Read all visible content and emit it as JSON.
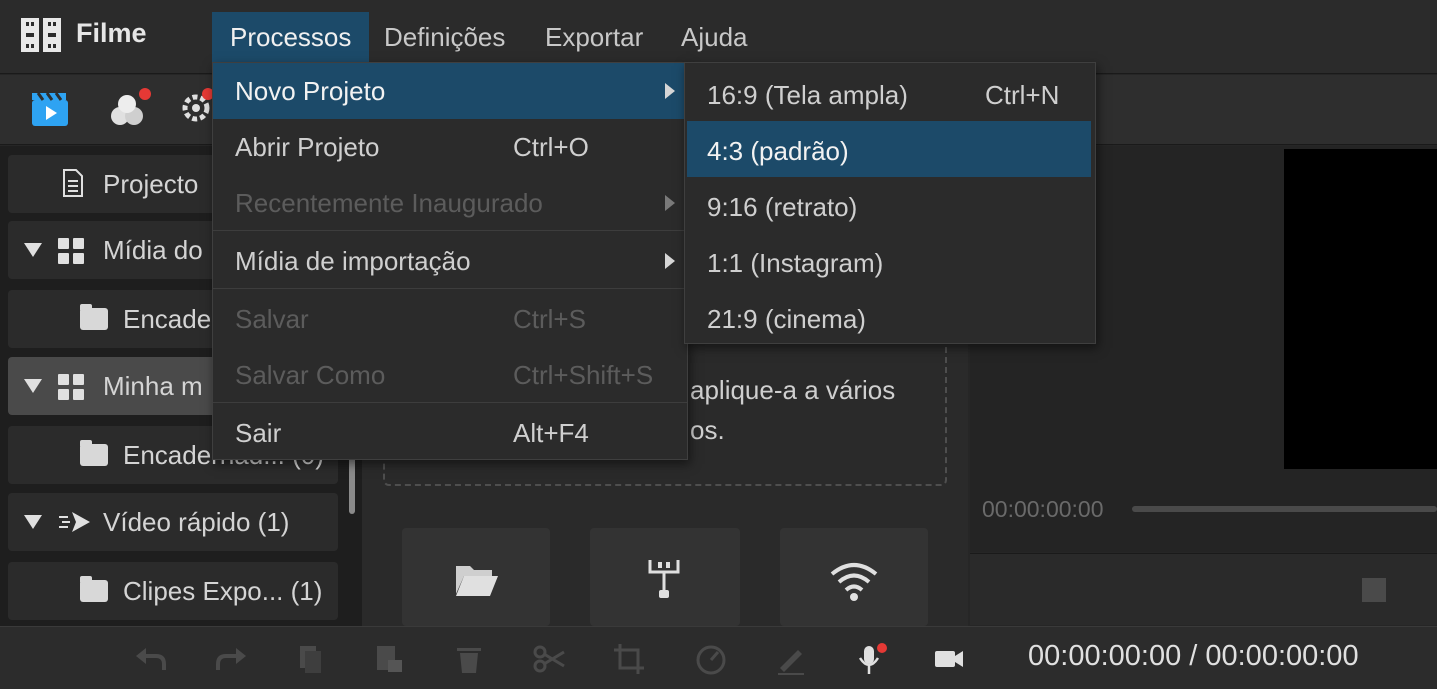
{
  "app": {
    "title": "Filme"
  },
  "menubar": {
    "items": [
      {
        "label": "Processos",
        "active": true
      },
      {
        "label": "Definições"
      },
      {
        "label": "Exportar"
      },
      {
        "label": "Ajuda"
      }
    ]
  },
  "toolbar": {
    "icons": [
      "media-clapper-icon",
      "effects-icon",
      "gear-sparkle-icon"
    ]
  },
  "sidebar": {
    "items": [
      {
        "label": "Projecto",
        "icon": "document-icon"
      },
      {
        "label": "Mídia do",
        "icon": "grid-icon"
      },
      {
        "label": "Encade",
        "icon": "folder-icon"
      },
      {
        "label": "Minha m",
        "icon": "grid-icon",
        "selected": true
      },
      {
        "label": "Encadernad... (0)",
        "icon": "folder-icon"
      },
      {
        "label": "Vídeo rápido (1)",
        "icon": "fast-forward-icon"
      },
      {
        "label": "Clipes Expo... (1)",
        "icon": "folder-icon"
      }
    ]
  },
  "center": {
    "drop_text_line1": "aplique-a a vários",
    "drop_text_line2": "os."
  },
  "preview": {
    "time": "00:00:00:00"
  },
  "bottombar": {
    "timecode": "00:00:00:00 / 00:00:00:00"
  },
  "process_menu": {
    "items": [
      {
        "label": "Novo Projeto",
        "shortcut": "",
        "submenu": true,
        "highlighted": true
      },
      {
        "label": "Abrir Projeto",
        "shortcut": "Ctrl+O"
      },
      {
        "label": "Recentemente Inaugurado",
        "shortcut": "",
        "submenu": true,
        "disabled": true
      },
      {
        "label": "Mídia de importação",
        "shortcut": "",
        "submenu": true
      },
      {
        "label": "Salvar",
        "shortcut": "Ctrl+S",
        "disabled": true
      },
      {
        "label": "Salvar Como",
        "shortcut": "Ctrl+Shift+S",
        "disabled": true
      },
      {
        "label": "Sair",
        "shortcut": "Alt+F4"
      }
    ]
  },
  "new_project_submenu": {
    "items": [
      {
        "label": "16:9 (Tela ampla)",
        "shortcut": "Ctrl+N"
      },
      {
        "label": "4:3 (padrão)",
        "shortcut": "",
        "highlighted": true
      },
      {
        "label": "9:16 (retrato)",
        "shortcut": ""
      },
      {
        "label": "1:1 (Instagram)",
        "shortcut": ""
      },
      {
        "label": "21:9 (cinema)",
        "shortcut": ""
      }
    ]
  },
  "colors": {
    "accent": "#1c4a69",
    "badge": "#e53935"
  }
}
